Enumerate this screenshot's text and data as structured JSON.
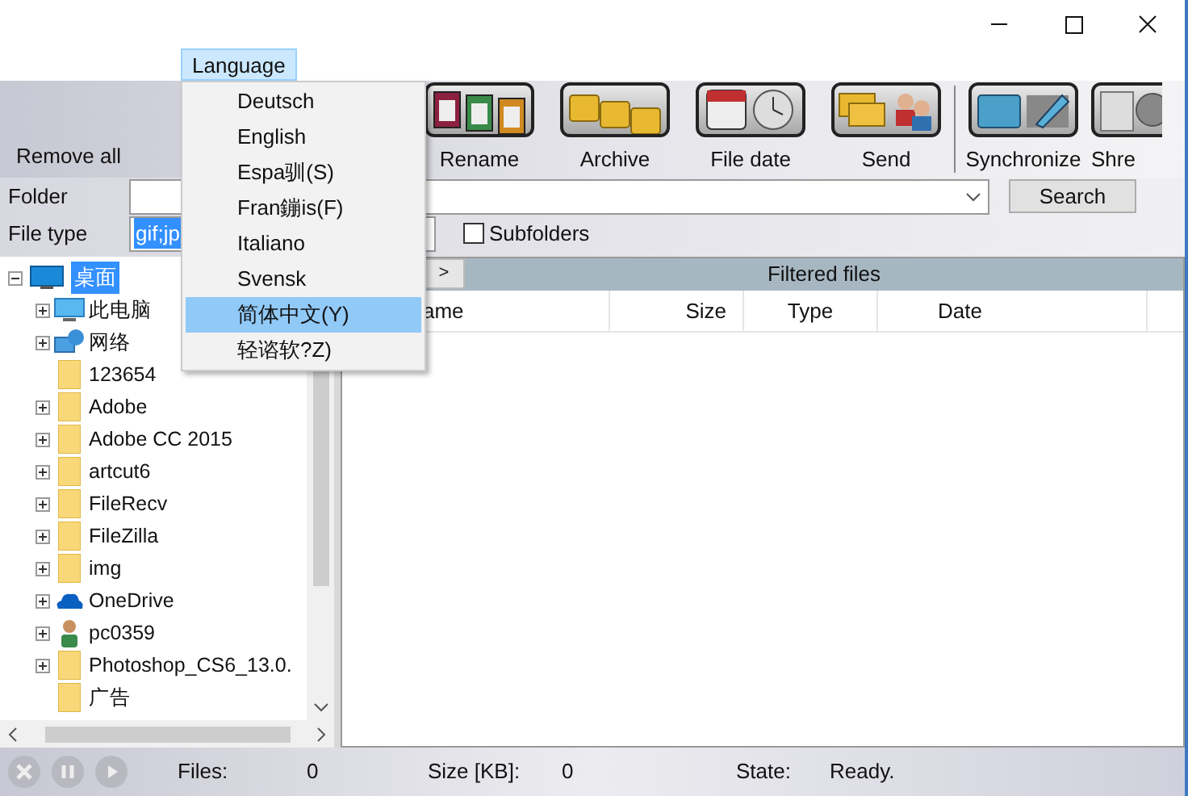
{
  "menu_bar": [
    {
      "label": "Language",
      "selected": true
    }
  ],
  "language_menu": [
    {
      "label": "Deutsch",
      "selected": false
    },
    {
      "label": "English",
      "selected": false
    },
    {
      "label": "Espa驯(S)",
      "selected": false
    },
    {
      "label": "Fran鏰is(F)",
      "selected": false
    },
    {
      "label": "Italiano",
      "selected": false
    },
    {
      "label": "Svensk",
      "selected": false
    },
    {
      "label": "简体中文(Y)",
      "selected": true
    },
    {
      "label": "轻谘软?Z)",
      "selected": false
    }
  ],
  "toolbar": {
    "left_label": "Remove all",
    "buttons": [
      {
        "label": "Rename",
        "kind": "rename"
      },
      {
        "label": "Archive",
        "kind": "archive"
      },
      {
        "label": "File date",
        "kind": "date"
      },
      {
        "label": "Send",
        "kind": "send"
      },
      {
        "label": "Synchronize",
        "kind": "sync"
      },
      {
        "label": "Shre",
        "kind": "shred"
      }
    ]
  },
  "filters": {
    "folder_label": "Folder",
    "file_type_label": "File type",
    "file_type_value": "gif;jp",
    "subfolders": {
      "label": "Subfolders",
      "checked": false
    },
    "search_button": "Search"
  },
  "tree": [
    {
      "label": "桌面",
      "kind": "desktop",
      "expanded": true,
      "selected": true,
      "children": [
        {
          "label": "此电脑",
          "kind": "computer",
          "expandable": true
        },
        {
          "label": "网络",
          "kind": "network",
          "expandable": true
        },
        {
          "label": "123654",
          "kind": "folder",
          "expandable": false
        },
        {
          "label": "Adobe",
          "kind": "folder",
          "expandable": true
        },
        {
          "label": "Adobe CC 2015",
          "kind": "folder",
          "expandable": true
        },
        {
          "label": "artcut6",
          "kind": "folder",
          "expandable": true
        },
        {
          "label": "FileRecv",
          "kind": "folder",
          "expandable": true
        },
        {
          "label": "FileZilla",
          "kind": "folder",
          "expandable": true
        },
        {
          "label": "img",
          "kind": "folder",
          "expandable": true
        },
        {
          "label": "OneDrive",
          "kind": "cloud",
          "expandable": true
        },
        {
          "label": "pc0359",
          "kind": "user",
          "expandable": true
        },
        {
          "label": "Photoshop_CS6_13.0.",
          "kind": "folder",
          "expandable": true
        },
        {
          "label": "广告",
          "kind": "folder",
          "expandable": false
        }
      ]
    }
  ],
  "results": {
    "nav_button": ">",
    "title": "Filtered files",
    "columns": [
      "ame",
      "Size",
      "Type",
      "Date"
    ]
  },
  "status_bar": {
    "files_label": "Files:",
    "files": "0",
    "size_label": "Size [KB]:",
    "size": "0",
    "state_label": "State:",
    "state": "Ready."
  }
}
